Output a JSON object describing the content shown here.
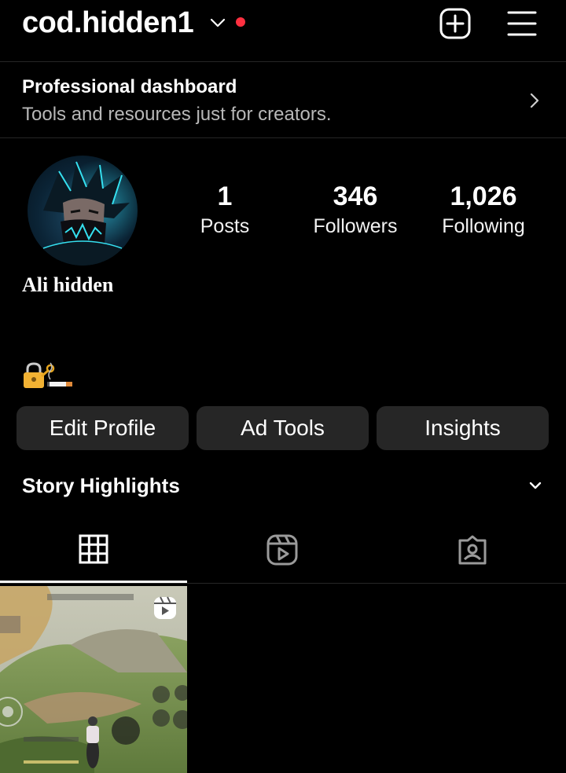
{
  "header": {
    "username": "cod.hidden1"
  },
  "dashboard": {
    "title": "Professional dashboard",
    "subtitle": "Tools and resources just for creators."
  },
  "profile": {
    "display_name": "Ali hidden",
    "stats": {
      "posts": {
        "value": "1",
        "label": "Posts"
      },
      "followers": {
        "value": "346",
        "label": "Followers"
      },
      "following": {
        "value": "1,026",
        "label": "Following"
      }
    },
    "bio_icons": [
      "lock-with-key-icon",
      "cigarette-icon"
    ]
  },
  "buttons": {
    "edit_profile": "Edit Profile",
    "ad_tools": "Ad Tools",
    "insights": "Insights"
  },
  "highlights": {
    "title": "Story Highlights"
  },
  "tabs": [
    "grid-icon",
    "reels-icon",
    "tagged-icon"
  ],
  "colors": {
    "background": "#000000",
    "button": "#262626",
    "notification_dot": "#ff3040",
    "secondary_text": "#b8b8b8"
  }
}
